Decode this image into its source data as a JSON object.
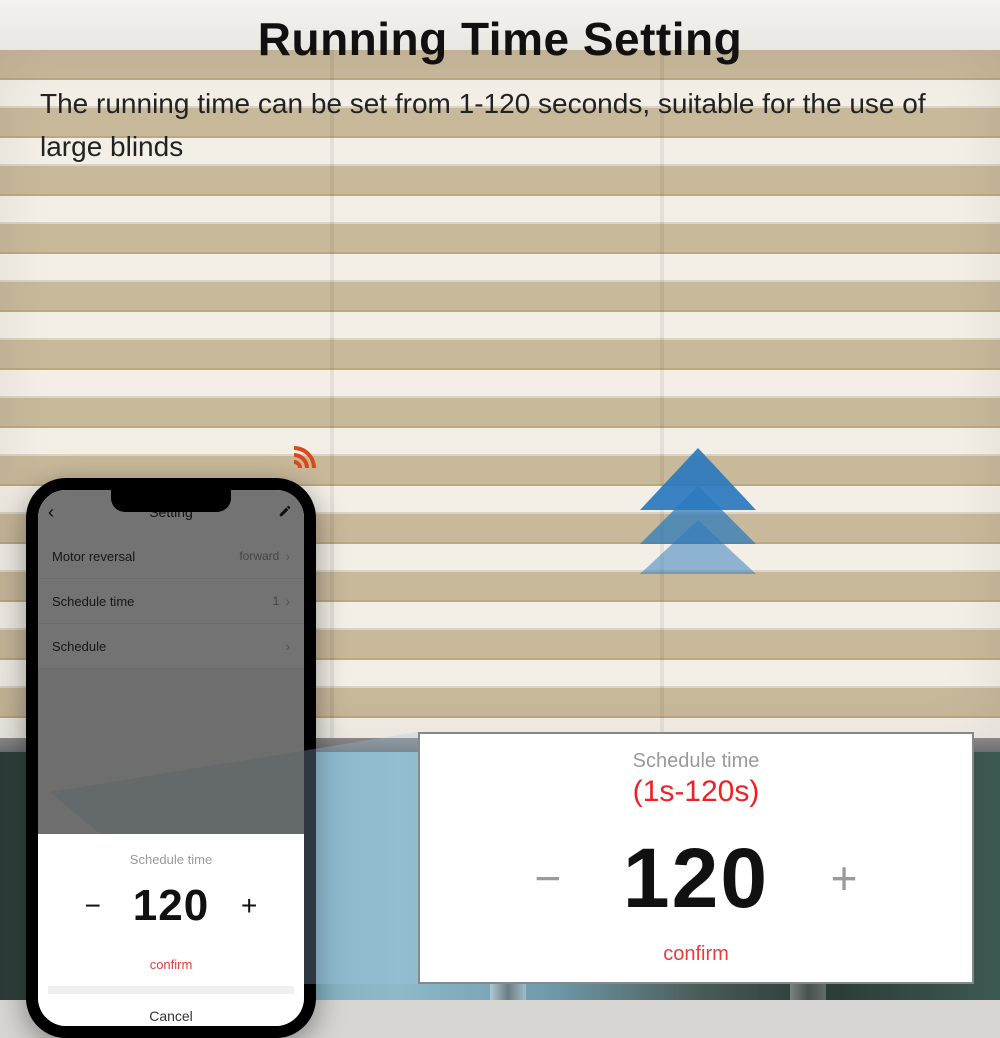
{
  "heading": "Running Time Setting",
  "subheading": "The running time can be set from 1-120 seconds, suitable for the use of large blinds",
  "phone": {
    "header": {
      "title": "Setting"
    },
    "rows": {
      "motor_reversal": {
        "label": "Motor reversal",
        "value": "forward"
      },
      "schedule_time": {
        "label": "Schedule time",
        "value": "1"
      },
      "schedule": {
        "label": "Schedule",
        "value": ""
      }
    },
    "sheet": {
      "title": "Schedule time",
      "minus": "−",
      "value": "120",
      "plus": "+",
      "confirm": "confirm",
      "cancel": "Cancel"
    }
  },
  "zoom": {
    "title": "Schedule time",
    "range": "(1s-120s)",
    "minus": "−",
    "value": "120",
    "plus": "+",
    "confirm": "confirm"
  },
  "colors": {
    "accent_red": "#e73c3c",
    "arrow_blue": "#2a78be"
  }
}
